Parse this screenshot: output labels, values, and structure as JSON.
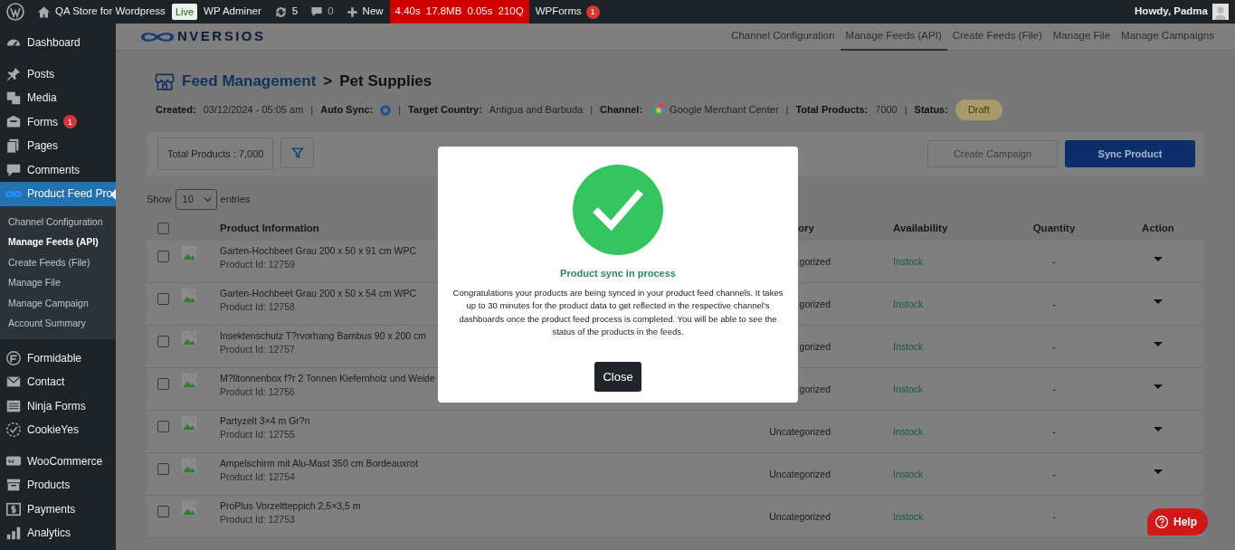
{
  "admin_bar": {
    "site": "QA Store for Wordpress",
    "live_badge": "Live",
    "adminer": "WP Adminer",
    "updates": "5",
    "comments": "0",
    "new": "New",
    "perf": [
      "4.40s",
      "17.8MB",
      "0.05s",
      "210Q"
    ],
    "wpforms": {
      "label": "WPForms",
      "badge": "1"
    },
    "greeting": "Howdy, Padma"
  },
  "sidebar": {
    "groups": [
      [
        {
          "label": "Dashboard",
          "selected": false
        }
      ],
      [
        {
          "label": "Posts",
          "selected": false
        },
        {
          "label": "Media",
          "selected": false
        },
        {
          "label": "Forms",
          "badge": "1",
          "selected": false
        },
        {
          "label": "Pages",
          "selected": false
        },
        {
          "label": "Comments",
          "selected": false
        },
        {
          "label": "Product Feed Pro",
          "selected": true,
          "children": [
            {
              "label": "Channel Configuration",
              "selected": false
            },
            {
              "label": "Manage Feeds (API)",
              "selected": true
            },
            {
              "label": "Create Feeds (File)",
              "selected": false
            },
            {
              "label": "Manage File",
              "selected": false
            },
            {
              "label": "Manage Campaign",
              "selected": false
            },
            {
              "label": "Account Summary",
              "selected": false
            }
          ]
        }
      ],
      [
        {
          "label": "Formidable",
          "selected": false
        },
        {
          "label": "Contact",
          "selected": false
        },
        {
          "label": "Ninja Forms",
          "selected": false
        },
        {
          "label": "CookieYes",
          "selected": false
        }
      ],
      [
        {
          "label": "WooCommerce",
          "selected": false
        },
        {
          "label": "Products",
          "selected": false
        },
        {
          "label": "Payments",
          "selected": false
        },
        {
          "label": "Analytics",
          "selected": false
        }
      ]
    ]
  },
  "logo": "NVERSIOS",
  "nav_tabs": [
    {
      "label": "Channel Configuration",
      "selected": false
    },
    {
      "label": "Manage Feeds (API)",
      "selected": true
    },
    {
      "label": "Create Feeds (File)",
      "selected": false
    },
    {
      "label": "Manage File",
      "selected": false
    },
    {
      "label": "Manage Campaigns",
      "selected": false
    }
  ],
  "title": {
    "link": "Feed Management",
    "separator": ">",
    "page": "Pet Supplies"
  },
  "meta": [
    {
      "kind": "text",
      "label": "Created:",
      "value": "03/12/2024 - 05:05 am"
    },
    {
      "kind": "sync",
      "separator": "|",
      "label": "Auto Sync:"
    },
    {
      "kind": "text",
      "separator": "|",
      "label": "Target Country:",
      "value": "Antigua and Barbuda"
    },
    {
      "kind": "channel",
      "separator": "|",
      "label": "Channel:",
      "value": "Google Merchant Center"
    },
    {
      "kind": "text",
      "separator": "|",
      "label": "Total Products:",
      "value": "7000"
    },
    {
      "kind": "badge",
      "separator": "|",
      "label": "Status:",
      "value": "Draft"
    }
  ],
  "toolbar": {
    "total": "Total Products : 7,000",
    "buttons": [
      {
        "label": "Create Campaign",
        "disabled": true
      },
      {
        "label": "Sync Product",
        "disabled": false
      }
    ]
  },
  "entries": {
    "show": "Show",
    "value": "10",
    "suffix": "entries"
  },
  "table": {
    "select_all": {
      "checked": false
    },
    "columns": [
      "Product Information",
      "ory",
      "Availability",
      "Quantity",
      "Action"
    ],
    "rows": [
      {
        "checked": false,
        "name": "Garten-Hochbeet Grau 200 x 50 x 91 cm WPC",
        "id": "Product Id: 12759",
        "category": "gorized",
        "availability": "Instock",
        "quantity": "-"
      },
      {
        "checked": false,
        "name": "Garten-Hochbeet Grau 200 x 50 x 54 cm WPC",
        "id": "Product Id: 12758",
        "category": "gorized",
        "availability": "Instock",
        "quantity": "-"
      },
      {
        "checked": false,
        "name": "Insektenschutz T?rvorhang Bambus 90 x 200 cm",
        "id": "Product Id: 12757",
        "category": "gorized",
        "availability": "Instock",
        "quantity": "-"
      },
      {
        "checked": false,
        "name": "M?lltonnenbox f?r 2 Tonnen Kiefernholz und Weide",
        "id": "Product Id: 12756",
        "category": "gorized",
        "availability": "Instock",
        "quantity": "-"
      },
      {
        "checked": false,
        "name": "Partyzelt 3×4 m Gr?n",
        "id": "Product Id: 12755",
        "category": "Uncategorized",
        "availability": "Instock",
        "quantity": "-"
      },
      {
        "checked": false,
        "name": "Ampelschirm mit Alu-Mast 350 cm Bordeauxrot",
        "id": "Product Id: 12754",
        "category": "Uncategorized",
        "availability": "Instock",
        "quantity": "-"
      },
      {
        "checked": false,
        "name": "ProPlus Vorzeltteppich 2,5×3,5 m",
        "id": "Product Id: 12753",
        "category": "Uncategorized",
        "availability": "Instock",
        "quantity": "-"
      }
    ]
  },
  "modal": {
    "title": "Product sync in process",
    "body": "Congratulations your products are being synced in your product feed channels. It takes up to 30 minutes for the product data to get reflected in the respective channel's dashboards once the product feed process is completed. You will be able to see the status of the products in the feeds.",
    "button": "Close"
  },
  "help": "Help"
}
